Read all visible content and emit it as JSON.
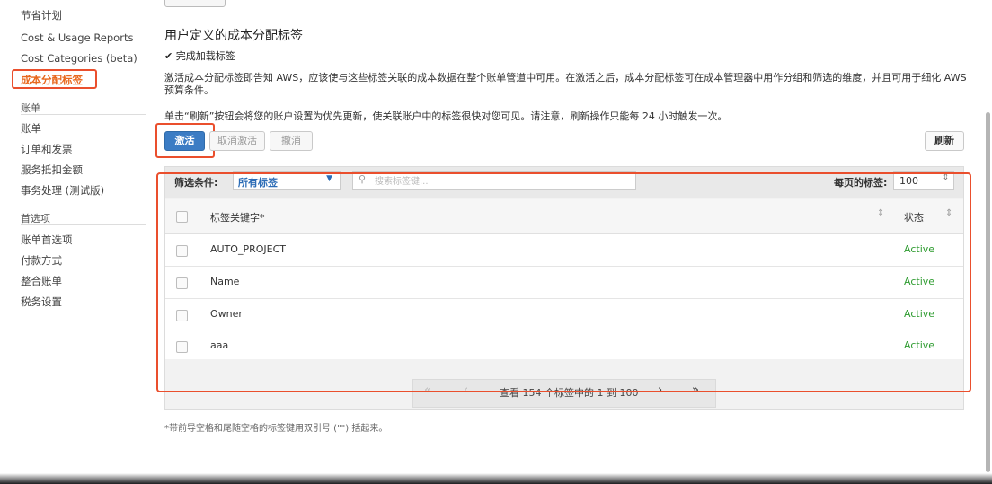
{
  "sidebar": {
    "items_top": [
      "节省计划",
      "Cost & Usage Reports",
      "Cost Categories (beta)",
      "成本分配标签"
    ],
    "section_billing": "账单",
    "items_billing": [
      "账单",
      "订单和发票",
      "服务抵扣金额",
      "事务处理 (测试版)"
    ],
    "section_prefs": "首选项",
    "items_prefs": [
      "账单首选项",
      "付款方式",
      "整合账单",
      "税务设置"
    ]
  },
  "main": {
    "title": "用户定义的成本分配标签",
    "status": "✔ 完成加载标签",
    "description": "激活成本分配标签即告知 AWS，应该使与这些标签关联的成本数据在整个账单管道中可用。在激活之后，成本分配标签可在成本管理器中用作分组和筛选的维度，并且可用于细化 AWS 预算条件。",
    "refresh_note": "单击“刷新”按钮会将您的账户设置为优先更新，使关联账户中的标签很快对您可见。请注意，刷新操作只能每 24 小时触发一次。"
  },
  "toolbar": {
    "activate": "激活",
    "deactivate": "取消激活",
    "undo": "撤消",
    "refresh": "刷新"
  },
  "filter": {
    "label": "筛选条件:",
    "selected": "所有标签",
    "search_placeholder": "搜索标签键...",
    "per_page_label": "每页的标签:",
    "per_page_value": "100"
  },
  "table": {
    "col_key": "标签关键字*",
    "col_state": "状态",
    "rows": [
      {
        "key": "AUTO_PROJECT",
        "state": "Active"
      },
      {
        "key": "Name",
        "state": "Active"
      },
      {
        "key": "Owner",
        "state": "Active"
      },
      {
        "key": "aaa",
        "state": "Active"
      }
    ]
  },
  "pagination": {
    "text": "查看 154 个标签中的 1 到 100"
  },
  "footnote": "*带前导空格和尾随空格的标签键用双引号 (\"\") 括起来。",
  "colors": {
    "accent": "#e8681e",
    "primary_button": "#3b7cc4",
    "active_status": "#2d9b2f",
    "highlight": "#ea4f2d"
  }
}
